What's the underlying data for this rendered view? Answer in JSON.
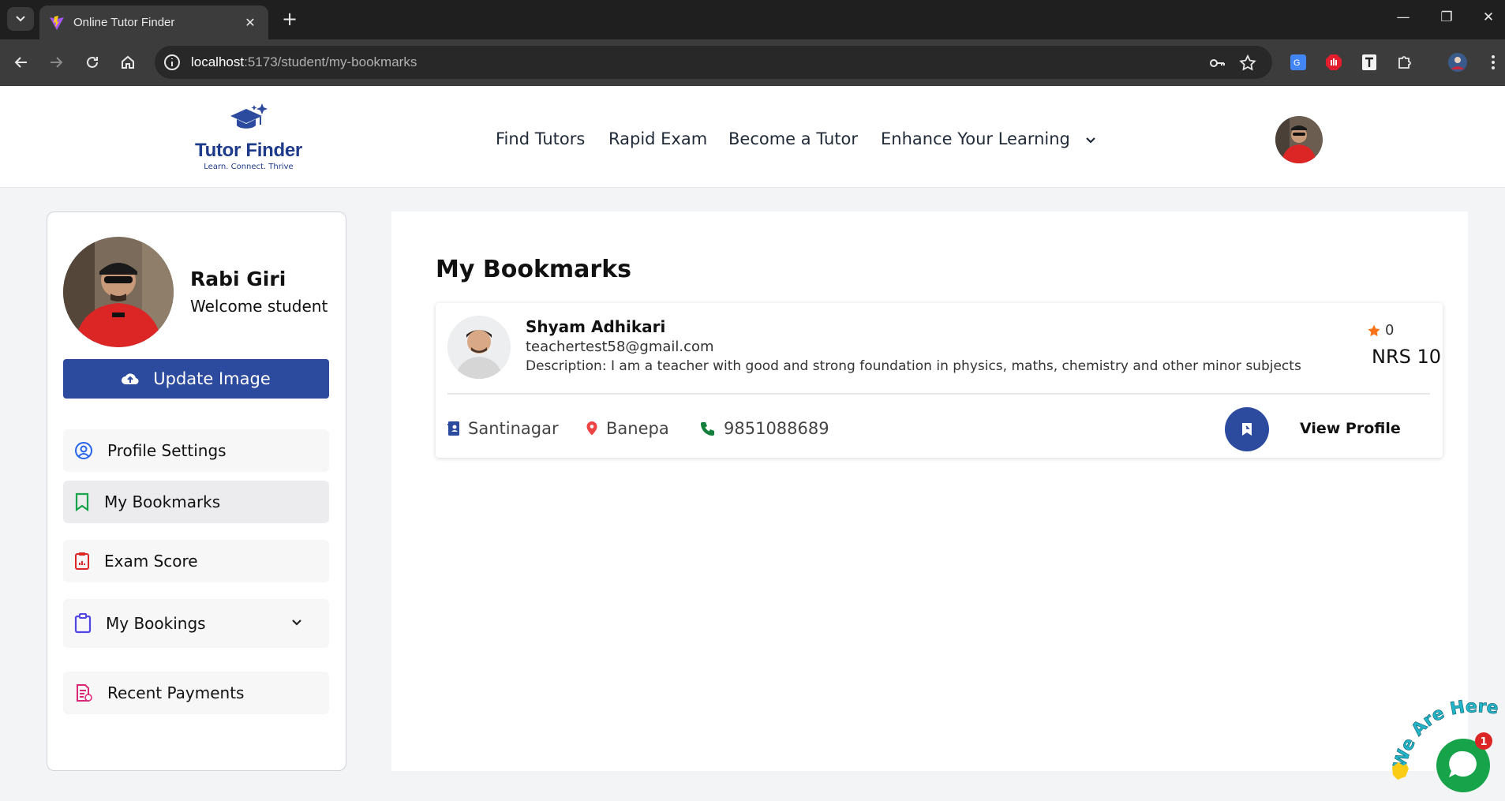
{
  "browser": {
    "tab_title": "Online Tutor Finder",
    "url_host": "localhost",
    "url_rest": ":5173/student/my-bookmarks",
    "accent": "#3c3c3c"
  },
  "header": {
    "logo_title": "Tutor Finder",
    "logo_tagline": "Learn. Connect. Thrive",
    "nav": [
      "Find Tutors",
      "Rapid Exam",
      "Become a Tutor",
      "Enhance Your Learning"
    ]
  },
  "sidebar": {
    "name": "Rabi Giri",
    "role": "Welcome student",
    "update_button": "Update Image",
    "menu": [
      {
        "label": "Profile Settings",
        "icon": "user-circle-icon"
      },
      {
        "label": "My Bookmarks",
        "icon": "bookmark-icon"
      },
      {
        "label": "Exam Score",
        "icon": "clipboard-chart-icon"
      },
      {
        "label": "My Bookings",
        "icon": "clipboard-icon"
      },
      {
        "label": "Recent Payments",
        "icon": "receipt-icon"
      }
    ]
  },
  "main": {
    "title": "My Bookmarks",
    "bookmarks": [
      {
        "name": "Shyam Adhikari",
        "email": "teachertest58@gmail.com",
        "description": "Description: I am a teacher with good and strong foundation in physics, maths, chemistry and other minor subjects",
        "rating": "0",
        "price": "NRS 10",
        "address": "Santinagar",
        "city": "Banepa",
        "phone": "9851088689",
        "view_label": "View Profile"
      }
    ]
  },
  "chat": {
    "badge_count": "1",
    "banner_text": "We Are Here"
  },
  "colors": {
    "primary": "#2c4a9e",
    "brand": "#1e3a8a",
    "chat": "#16a34a"
  }
}
